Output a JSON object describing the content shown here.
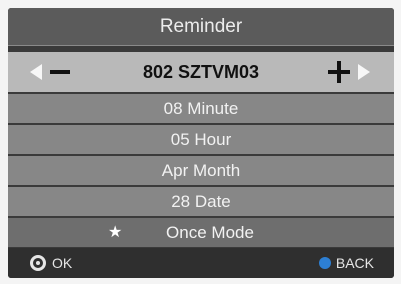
{
  "header": {
    "title": "Reminder"
  },
  "channel": {
    "name": "802 SZTVM03"
  },
  "rows": [
    {
      "label": "08 Minute"
    },
    {
      "label": "05 Hour"
    },
    {
      "label": "Apr Month"
    },
    {
      "label": "28 Date"
    },
    {
      "label": "Once Mode"
    }
  ],
  "footer": {
    "ok_label": "OK",
    "back_label": "BACK"
  },
  "colors": {
    "back_button": "#2d7fd3",
    "header_bg": "#5b5b5b",
    "channel_bar_bg": "#b9b9b9",
    "row_bg": "#878787"
  },
  "icons": {
    "left": "arrow-left-icon",
    "minus": "minus-icon",
    "plus": "plus-icon",
    "right": "arrow-right-icon",
    "star": "star-icon",
    "ok": "ok-icon",
    "back": "back-icon"
  }
}
